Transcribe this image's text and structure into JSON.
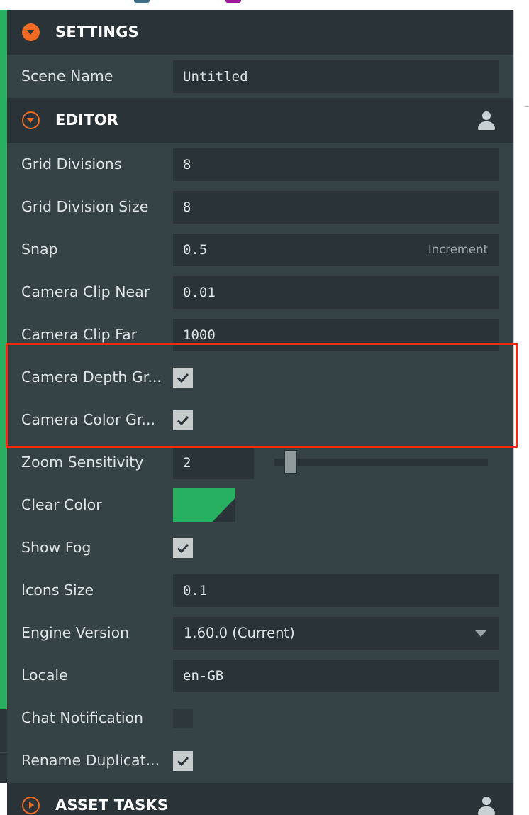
{
  "colors": {
    "accent": "#f06a22",
    "clear_color": "#27b060",
    "highlight": "#f0290f",
    "panel_bg": "#364346",
    "header_bg": "#2a3338"
  },
  "settings": {
    "title": "SETTINGS",
    "icon": "expand-arrow-icon"
  },
  "scene_name": {
    "label": "Scene Name",
    "value": "Untitled"
  },
  "editor": {
    "title": "EDITOR",
    "icon": "collapse-arrow-icon",
    "user_icon": "user-icon",
    "grid_divisions": {
      "label": "Grid Divisions",
      "value": "8"
    },
    "grid_division_size": {
      "label": "Grid Division Size",
      "value": "8"
    },
    "snap": {
      "label": "Snap",
      "value": "0.5",
      "suffix": "Increment"
    },
    "camera_clip_near": {
      "label": "Camera Clip Near",
      "value": "0.01"
    },
    "camera_clip_far": {
      "label": "Camera Clip Far",
      "value": "1000"
    },
    "camera_depth_grab": {
      "label": "Camera Depth Gr...",
      "checked": true
    },
    "camera_color_grab": {
      "label": "Camera Color Gr...",
      "checked": true
    },
    "zoom_sensitivity": {
      "label": "Zoom Sensitivity",
      "value": "2",
      "slider_fraction": 0.05
    },
    "clear_color": {
      "label": "Clear Color",
      "color": "#27b060"
    },
    "show_fog": {
      "label": "Show Fog",
      "checked": true
    },
    "icons_size": {
      "label": "Icons Size",
      "value": "0.1"
    },
    "engine_version": {
      "label": "Engine Version",
      "value": "1.60.0 (Current)"
    },
    "locale": {
      "label": "Locale",
      "value": "en-GB"
    },
    "chat_notification": {
      "label": "Chat Notification",
      "checked": false
    },
    "rename_duplicated": {
      "label": "Rename Duplicat...",
      "checked": true
    }
  },
  "asset_tasks": {
    "title": "ASSET TASKS",
    "icon": "collapsed-arrow-icon",
    "user_icon": "user-icon"
  }
}
